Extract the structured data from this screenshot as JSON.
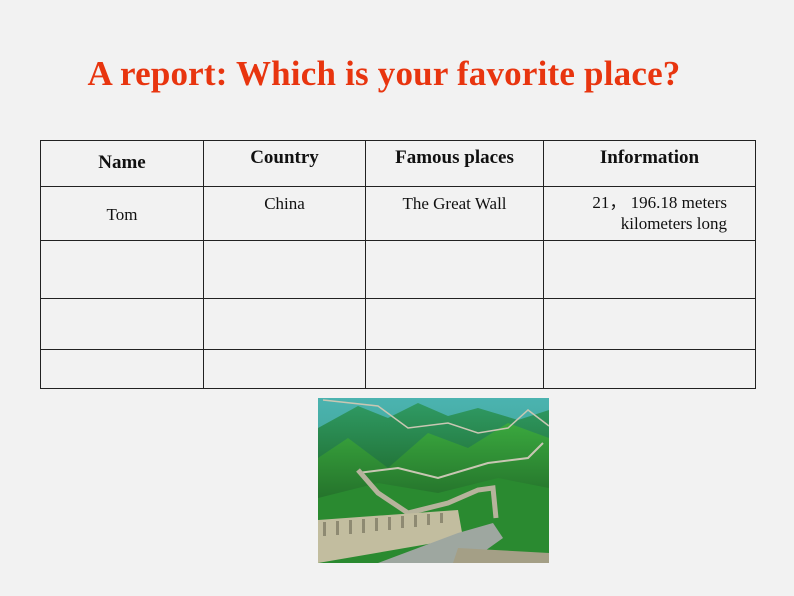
{
  "title": "A report: Which is your favorite place?",
  "table": {
    "headers": [
      "Name",
      "Country",
      "Famous places",
      "Information"
    ],
    "rows": [
      {
        "name": "Tom",
        "country": "China",
        "famous_place": "The Great Wall",
        "information_line1": "21，  196.18 meters",
        "information_line2": "kilometers long"
      },
      {
        "name": "",
        "country": "",
        "famous_place": "",
        "information_line1": "",
        "information_line2": ""
      },
      {
        "name": "",
        "country": "",
        "famous_place": "",
        "information_line1": "",
        "information_line2": ""
      },
      {
        "name": "",
        "country": "",
        "famous_place": "",
        "information_line1": "",
        "information_line2": ""
      }
    ]
  },
  "image": {
    "subject": "great-wall-photo",
    "colors": {
      "sky": "#3fa8a8",
      "mountain_dark": "#1d6a2c",
      "mountain_light": "#3c9a3a",
      "wall": "#b9b49a"
    }
  },
  "colors": {
    "title": "#e8350f",
    "background": "#f2f2f2",
    "border": "#222222"
  }
}
